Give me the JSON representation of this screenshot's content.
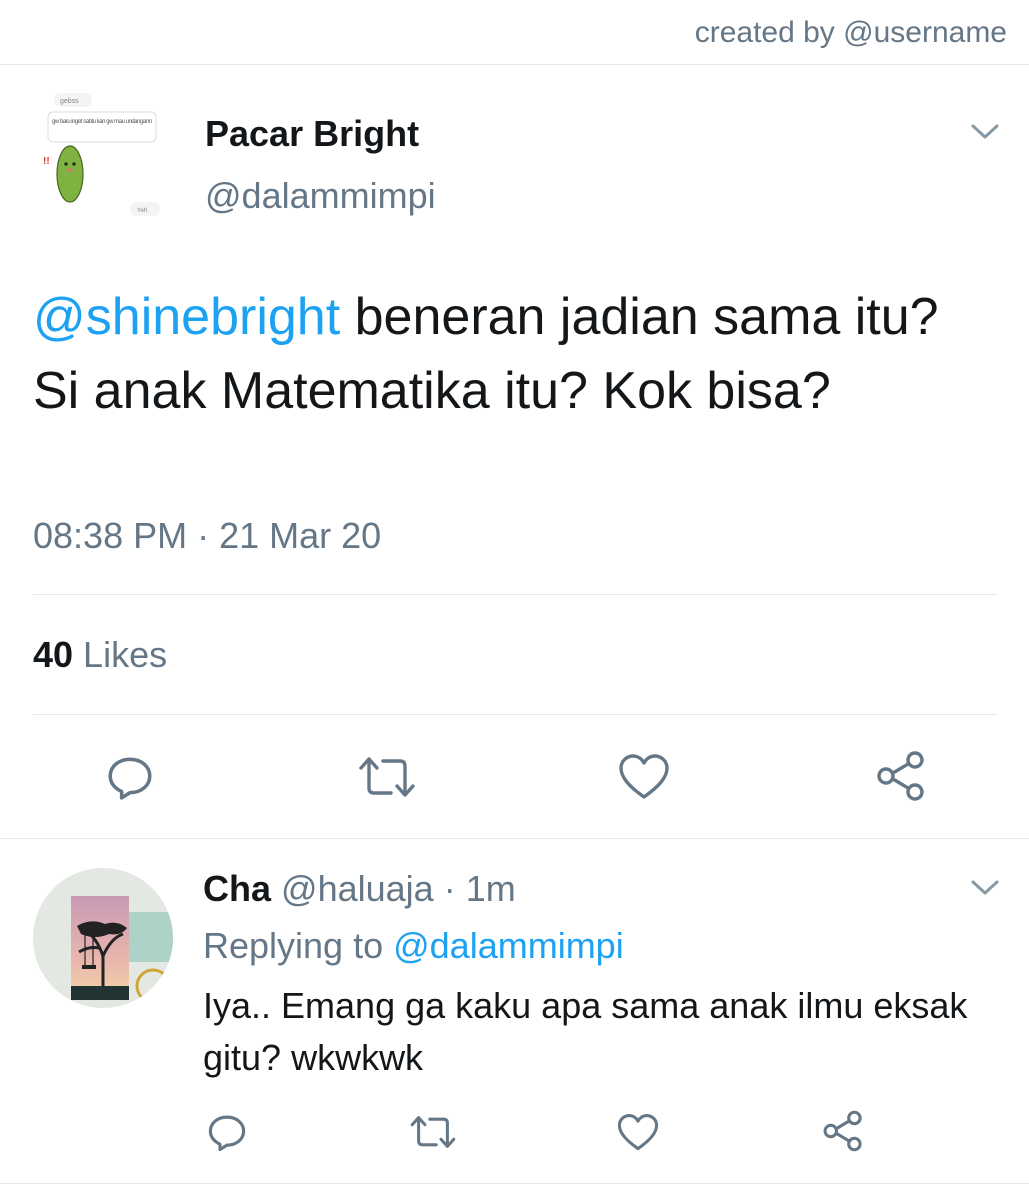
{
  "header": {
    "credit": "created by @username"
  },
  "tweet": {
    "name": "Pacar Bright",
    "handle": "@dalammimpi",
    "avatar_texts": {
      "bubble1": "gebss",
      "bubble2": "gw baru inget sabtu kan gw mau undangann",
      "bubble3": "Yeh"
    },
    "mention": "@shinebright",
    "text": " beneran jadian sama itu? Si anak Matematika itu? Kok bisa?",
    "time": "08:38 PM · 21 Mar 20",
    "likes_count": "40",
    "likes_label": " Likes"
  },
  "reply": {
    "name": "Cha",
    "handle": "@haluaja",
    "sep": " · ",
    "time": "1m",
    "replying_prefix": "Replying to ",
    "replying_handle": "@dalammimpi",
    "text": "Iya.. Emang ga kaku apa sama anak ilmu eksak gitu? wkwkwk"
  },
  "icons": {
    "reply": "reply-icon",
    "retweet": "retweet-icon",
    "like": "heart-icon",
    "share": "share-icon",
    "menu": "chevron-down-icon"
  },
  "colors": {
    "link": "#1da1f2",
    "secondary": "#657786",
    "text": "#14171a",
    "divider": "#e1e8ed"
  }
}
